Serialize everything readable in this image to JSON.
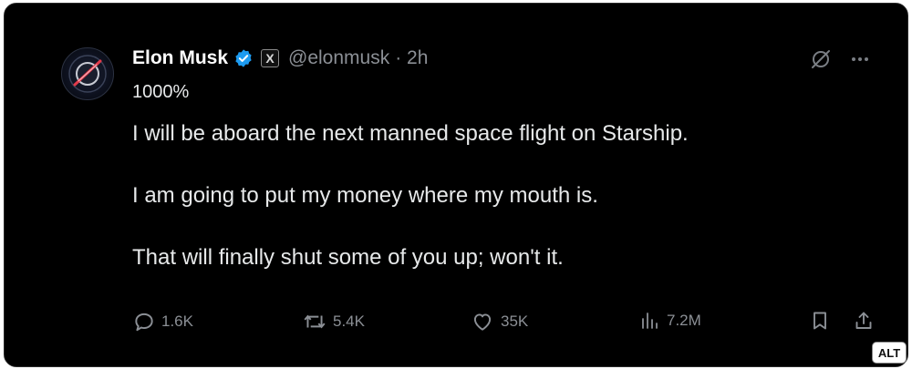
{
  "author": {
    "name": "Elon Musk",
    "handle": "@elonmusk",
    "time": "· 2h",
    "affiliate_badge": "X"
  },
  "subline": "1000%",
  "tweet": {
    "paragraphs": [
      "I will be aboard the next manned space flight on Starship.",
      "I am going to put my money where my mouth is.",
      "That will finally shut some of you up; won't it."
    ]
  },
  "stats": {
    "replies": "1.6K",
    "reposts": "5.4K",
    "likes": "35K",
    "views": "7.2M"
  },
  "icons": {
    "verified": "verified-badge-icon",
    "grok": "slashed-circle-icon",
    "more": "more-icon",
    "reply": "reply-icon",
    "repost": "repost-icon",
    "like": "heart-icon",
    "views": "bar-chart-icon",
    "bookmark": "bookmark-icon",
    "share": "share-icon"
  },
  "alt_label": "ALT",
  "colors": {
    "background": "#000000",
    "text": "#e7e9ea",
    "muted": "#8b8f95",
    "verified": "#1d9bf0"
  }
}
